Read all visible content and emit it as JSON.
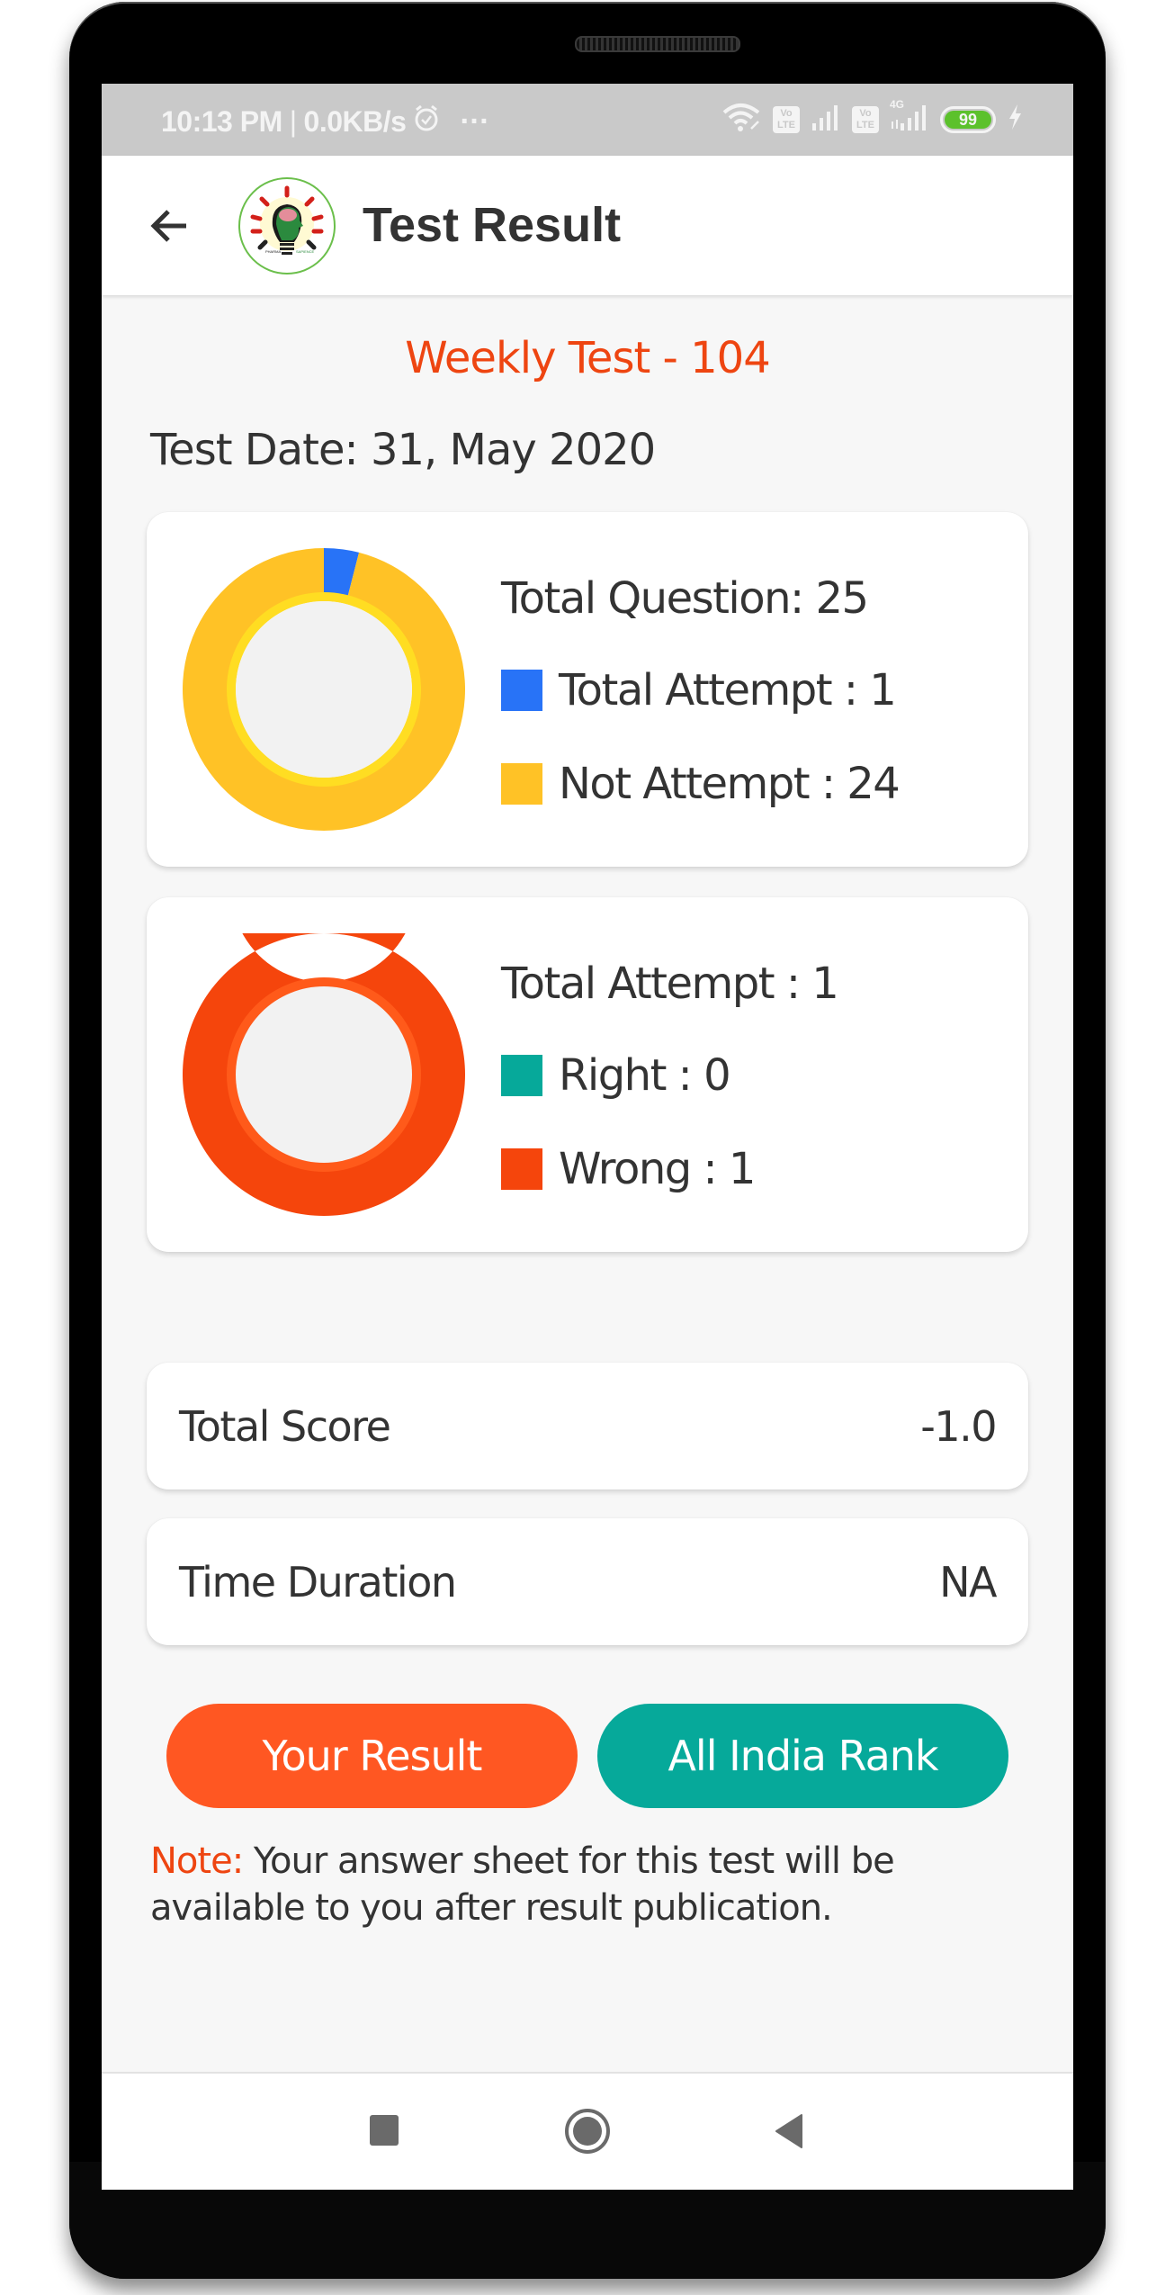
{
  "status_bar": {
    "time": "10:13 PM",
    "separator": "|",
    "net_speed": "0.0KB/s",
    "more": "···",
    "volte_label": "Vo LTE",
    "network_type": "4G",
    "battery_level": "99",
    "icons": [
      "alarm-icon",
      "wifi-icon",
      "volte-icon",
      "signal-icon",
      "volte-icon",
      "signal-4g-icon",
      "battery-icon",
      "charging-icon"
    ]
  },
  "app_bar": {
    "title": "Test Result",
    "back_icon": "arrow-left-icon",
    "logo_text_left": "PHARMA",
    "logo_text_right": "SAPIENCE"
  },
  "test": {
    "name": "Weekly Test - 104",
    "date": "Test Date: 31, May 2020"
  },
  "colors": {
    "accent_orange": "#ee4511",
    "attempted_blue": "#2873f7",
    "not_attempted_yellow": "#ffc226",
    "right_teal": "#06a99a",
    "wrong_orange": "#f5450c",
    "button_result": "#ff5722",
    "button_rank": "#06a99a"
  },
  "chart_data": [
    {
      "type": "pie",
      "variant": "donut",
      "title": "Total Question: 25",
      "categories": [
        "Total Attempt",
        "Not Attempt"
      ],
      "values": [
        1,
        24
      ],
      "colors": [
        "#2873f7",
        "#ffc226"
      ],
      "legend": [
        "Total Attempt : 1",
        "Not Attempt : 24"
      ],
      "legend_placement": "right"
    },
    {
      "type": "pie",
      "variant": "donut",
      "title": "Total Attempt : 1",
      "categories": [
        "Right",
        "Wrong"
      ],
      "values": [
        0,
        1
      ],
      "colors": [
        "#06a99a",
        "#f5450c"
      ],
      "legend": [
        "Right : 0",
        "Wrong : 1"
      ],
      "legend_placement": "right"
    }
  ],
  "summary": {
    "total_score_label": "Total Score",
    "total_score_value": "-1.0",
    "time_duration_label": "Time Duration",
    "time_duration_value": "NA"
  },
  "buttons": {
    "your_result": "Your Result",
    "all_india_rank": "All India Rank"
  },
  "note": {
    "label": "Note:",
    "text": " Your answer sheet for this test will be available to you after result publication."
  },
  "nav_bar": {
    "recents": "recents-icon",
    "home": "home-icon",
    "back": "back-icon"
  }
}
